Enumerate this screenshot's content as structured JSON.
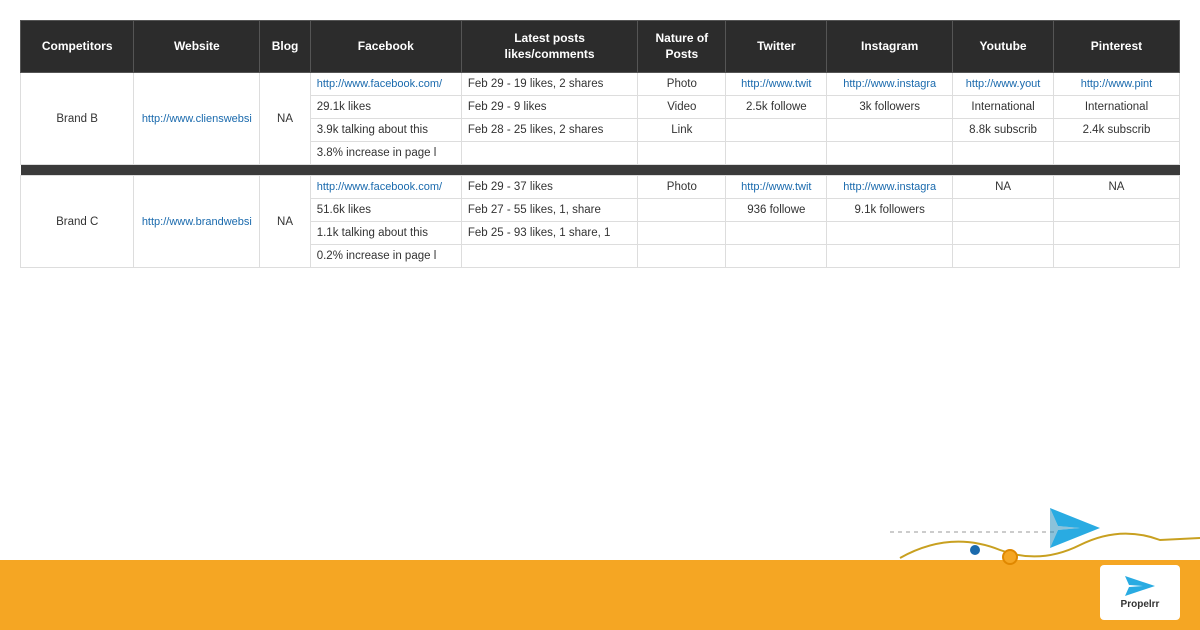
{
  "header": {
    "columns": [
      {
        "key": "competitors",
        "label": "Competitors"
      },
      {
        "key": "website",
        "label": "Website"
      },
      {
        "key": "blog",
        "label": "Blog"
      },
      {
        "key": "facebook",
        "label": "Facebook"
      },
      {
        "key": "latest_posts",
        "label": "Latest posts likes/comments"
      },
      {
        "key": "nature",
        "label": "Nature of Posts"
      },
      {
        "key": "twitter",
        "label": "Twitter"
      },
      {
        "key": "instagram",
        "label": "Instagram"
      },
      {
        "key": "youtube",
        "label": "Youtube"
      },
      {
        "key": "pinterest",
        "label": "Pinterest"
      }
    ]
  },
  "brand_b": {
    "name": "Brand B",
    "website": "http://www.clienswebsi",
    "blog": "NA",
    "rows": [
      {
        "facebook": "http://www.facebook.com/",
        "latest": "Feb 29 - 19 likes, 2 shares",
        "nature": "Photo",
        "twitter": "http://www.twit",
        "instagram": "http://www.instagra",
        "youtube": "http://www.yout",
        "pinterest": "http://www.pint"
      },
      {
        "facebook": "29.1k likes",
        "latest": "Feb 29 - 9 likes",
        "nature": "Video",
        "twitter": "2.5k followe",
        "instagram": "3k followers",
        "youtube": "International",
        "pinterest": "International"
      },
      {
        "facebook": "3.9k talking about this",
        "latest": "Feb 28 - 25 likes, 2 shares",
        "nature": "Link",
        "twitter": "",
        "instagram": "",
        "youtube": "8.8k subscrib",
        "pinterest": "2.4k subscrib"
      },
      {
        "facebook": "3.8% increase in page l",
        "latest": "",
        "nature": "",
        "twitter": "",
        "instagram": "",
        "youtube": "",
        "pinterest": ""
      }
    ]
  },
  "brand_c": {
    "name": "Brand C",
    "website": "http://www.brandwebsi",
    "blog": "NA",
    "rows": [
      {
        "facebook": "http://www.facebook.com/",
        "latest": "Feb 29 - 37 likes",
        "nature": "Photo",
        "twitter": "http://www.twit",
        "instagram": "http://www.instagra",
        "youtube": "NA",
        "pinterest": "NA"
      },
      {
        "facebook": "51.6k likes",
        "latest": "Feb 27 - 55 likes, 1, share",
        "nature": "",
        "twitter": "936 followe",
        "instagram": "9.1k followers",
        "youtube": "",
        "pinterest": ""
      },
      {
        "facebook": "1.1k talking about this",
        "latest": "Feb 25 - 93 likes, 1 share, 1",
        "nature": "",
        "twitter": "",
        "instagram": "",
        "youtube": "",
        "pinterest": ""
      },
      {
        "facebook": "0.2% increase in page l",
        "latest": "",
        "nature": "",
        "twitter": "",
        "instagram": "",
        "youtube": "",
        "pinterest": ""
      }
    ]
  },
  "logo": {
    "name": "Propelrr"
  }
}
